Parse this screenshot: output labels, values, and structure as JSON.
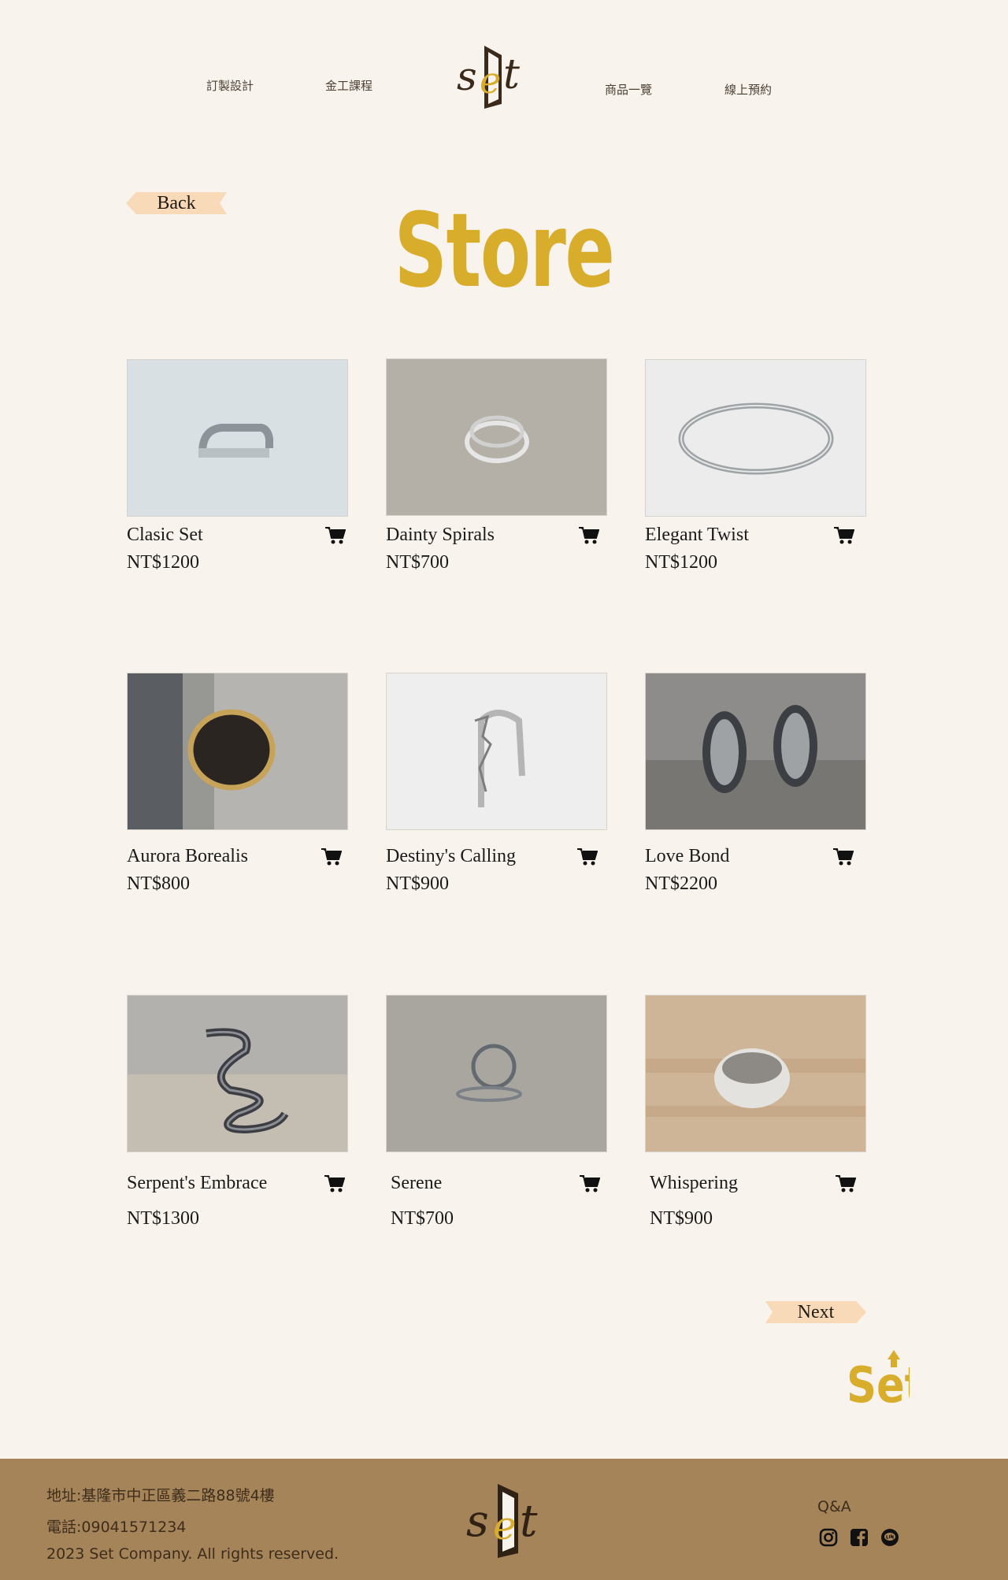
{
  "nav": {
    "links": [
      "訂製設計",
      "金工課程",
      "商品一覽",
      "線上預約"
    ],
    "logo_icon": "set-door-logo-icon"
  },
  "back_label": "Back",
  "next_label": "Next",
  "title": "Store",
  "products": [
    {
      "name": "Clasic Set",
      "price": "NT$1200"
    },
    {
      "name": "Dainty Spirals",
      "price": "NT$700"
    },
    {
      "name": "Elegant Twist",
      "price": "NT$1200"
    },
    {
      "name": "Aurora Borealis",
      "price": "NT$800"
    },
    {
      "name": "Destiny's Calling",
      "price": "NT$900"
    },
    {
      "name": "Love Bond",
      "price": "NT$2200"
    },
    {
      "name": "Serpent's Embrace",
      "price": "NT$1300"
    },
    {
      "name": "Serene",
      "price": "NT$700"
    },
    {
      "name": "Whispering",
      "price": "NT$900"
    }
  ],
  "footer": {
    "address": "地址:基隆市中正區義二路88號4樓",
    "phone": "電話:09041571234",
    "copyright": "2023 Set Company. All rights reserved.",
    "qa": "Q&A",
    "social_icons": [
      "instagram-icon",
      "facebook-icon",
      "line-icon"
    ]
  },
  "colors": {
    "background": "#f8f3ec",
    "accent_gold": "#d9ad2c",
    "ribbon": "#f8d9b8",
    "footer": "#a5845a",
    "logo_brown": "#3b2a1a"
  }
}
